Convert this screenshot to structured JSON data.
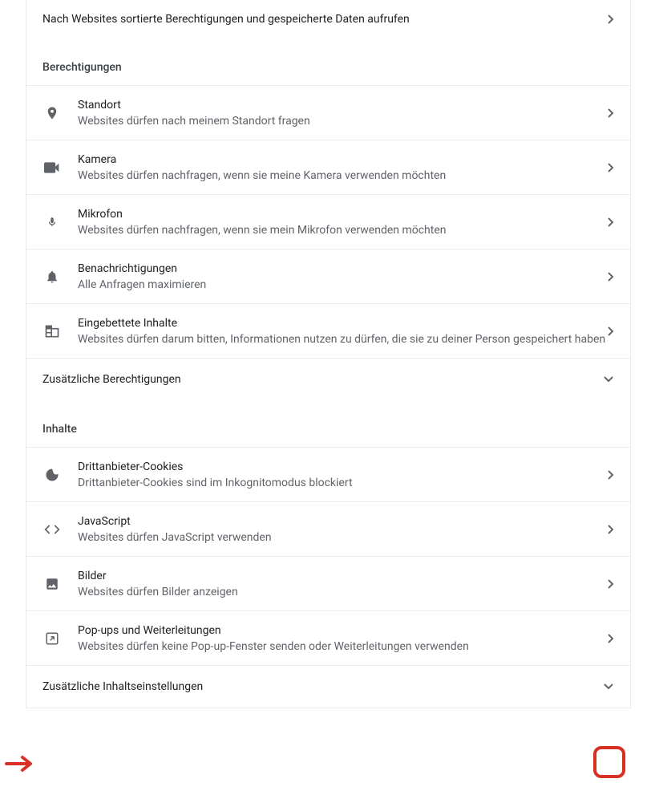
{
  "topRow": {
    "label": "Nach Websites sortierte Berechtigungen und gespeicherte Daten aufrufen"
  },
  "permissions": {
    "header": "Berechtigungen",
    "items": [
      {
        "title": "Standort",
        "subtitle": "Websites dürfen nach meinem Standort fragen"
      },
      {
        "title": "Kamera",
        "subtitle": "Websites dürfen nachfragen, wenn sie meine Kamera verwenden möchten"
      },
      {
        "title": "Mikrofon",
        "subtitle": "Websites dürfen nachfragen, wenn sie mein Mikrofon verwenden möchten"
      },
      {
        "title": "Benachrichtigungen",
        "subtitle": "Alle Anfragen maximieren"
      },
      {
        "title": "Eingebettete Inhalte",
        "subtitle": "Websites dürfen darum bitten, Informationen nutzen zu dürfen, die sie zu deiner Person gespeichert haben"
      }
    ],
    "additional": "Zusätzliche Berechtigungen"
  },
  "content": {
    "header": "Inhalte",
    "items": [
      {
        "title": "Drittanbieter-Cookies",
        "subtitle": "Drittanbieter-Cookies sind im Inkognitomodus blockiert"
      },
      {
        "title": "JavaScript",
        "subtitle": "Websites dürfen JavaScript verwenden"
      },
      {
        "title": "Bilder",
        "subtitle": "Websites dürfen Bilder anzeigen"
      },
      {
        "title": "Pop-ups und Weiterleitungen",
        "subtitle": "Websites dürfen keine Pop-up-Fenster senden oder Weiterleitungen verwenden"
      }
    ],
    "additional": "Zusätzliche Inhaltseinstellungen"
  }
}
